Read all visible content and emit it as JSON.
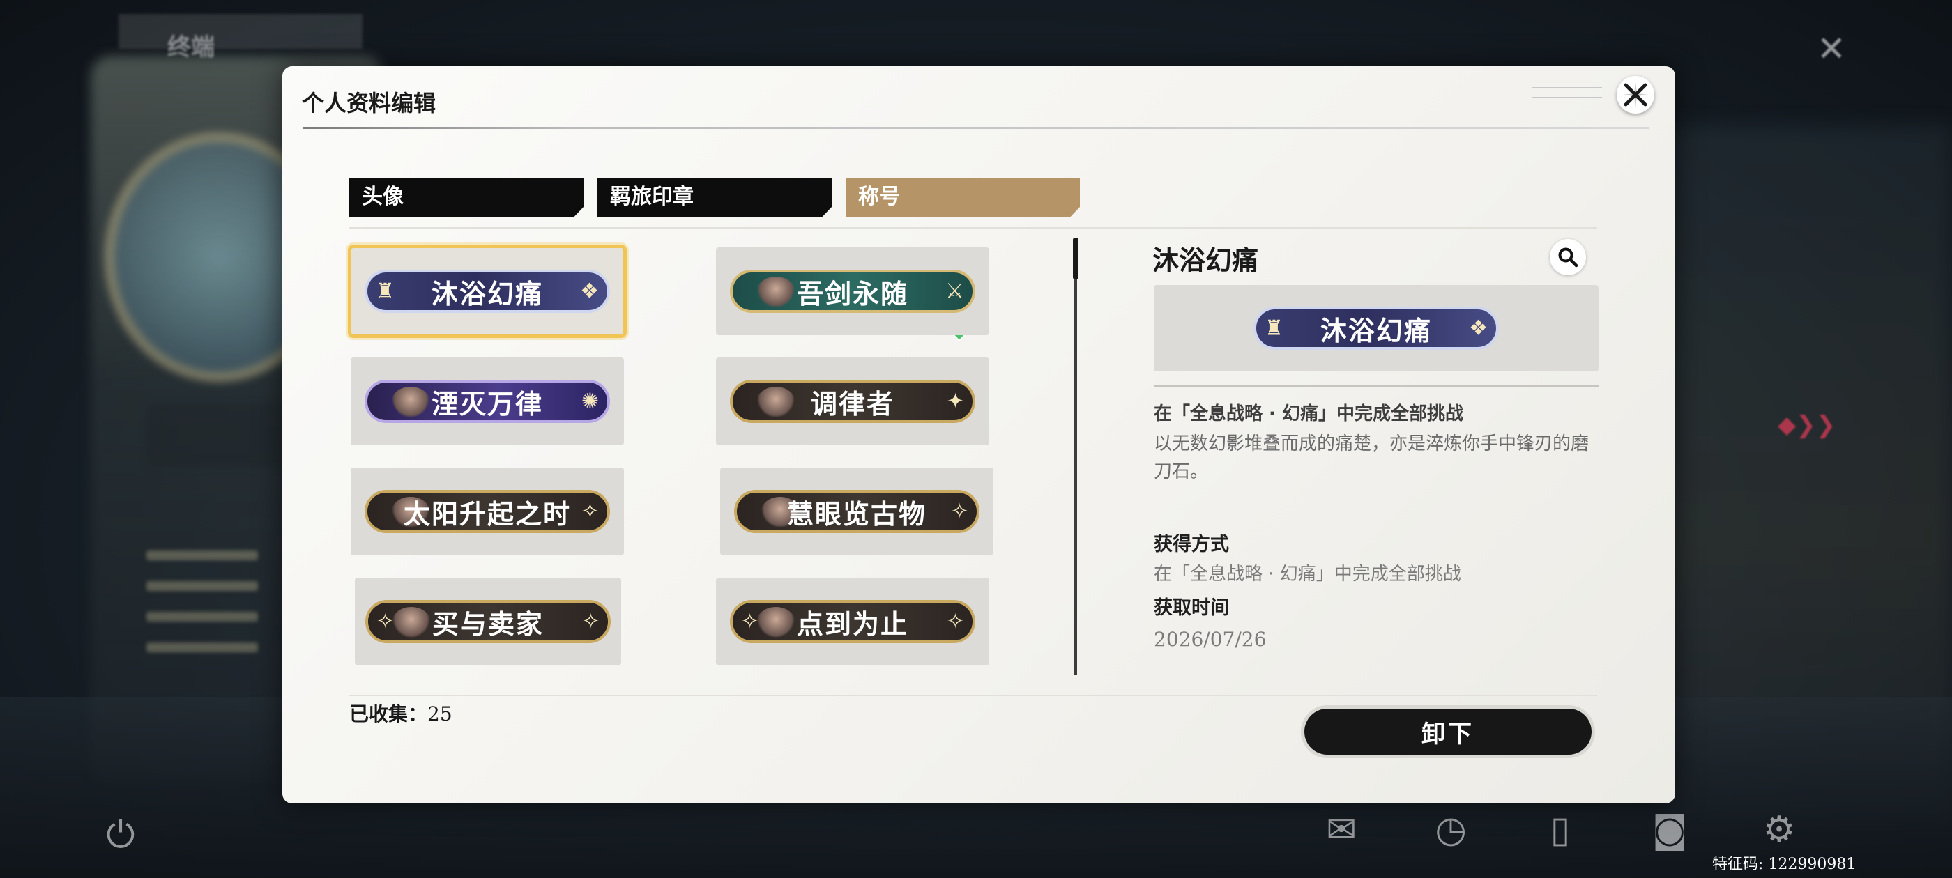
{
  "background": {
    "top_label": "终端"
  },
  "modal": {
    "title": "个人资料编辑"
  },
  "tabs": [
    {
      "label": "头像",
      "active": false
    },
    {
      "label": "羁旅印章",
      "active": false
    },
    {
      "label": "称号",
      "active": true
    }
  ],
  "titles": [
    {
      "name": "沐浴幻痛",
      "style": "violet",
      "selected": true,
      "equipped": true
    },
    {
      "name": "吾剑永随",
      "style": "teal",
      "selected": false,
      "equipped": false
    },
    {
      "name": "湮灭万律",
      "style": "galaxy",
      "selected": false,
      "equipped": false
    },
    {
      "name": "调律者",
      "style": "dark",
      "selected": false,
      "equipped": false
    },
    {
      "name": "太阳升起之时",
      "style": "dark",
      "selected": false,
      "equipped": false
    },
    {
      "name": "慧眼览古物",
      "style": "dark",
      "selected": false,
      "equipped": false
    },
    {
      "name": "买与卖家",
      "style": "dark",
      "selected": false,
      "equipped": false
    },
    {
      "name": "点到为止",
      "style": "dark",
      "selected": false,
      "equipped": false
    }
  ],
  "collected": {
    "label": "已收集：",
    "count": "25"
  },
  "detail": {
    "name": "沐浴幻痛",
    "preview_name": "沐浴幻痛",
    "condition": "在「全息战略 · 幻痛」中完成全部挑战",
    "description": "以无数幻影堆叠而成的痛楚，亦是淬炼你手中锋刃的磨刀石。",
    "obtain_label": "获得方式",
    "obtain_value": "在「全息战略 · 幻痛」中完成全部挑战",
    "time_label": "获取时间",
    "time_value": "2026/07/26"
  },
  "actions": {
    "unequip": "卸下"
  },
  "footer": {
    "code": "特征码: 122990981"
  },
  "colors": {
    "active_tab": "#b59468",
    "selection": "#f0c556",
    "equipped": "#4cc36b"
  },
  "icons": [
    "close-icon",
    "search-icon",
    "power-icon",
    "mail-icon",
    "clock-icon",
    "phone-icon",
    "camera-icon",
    "settings-icon"
  ]
}
